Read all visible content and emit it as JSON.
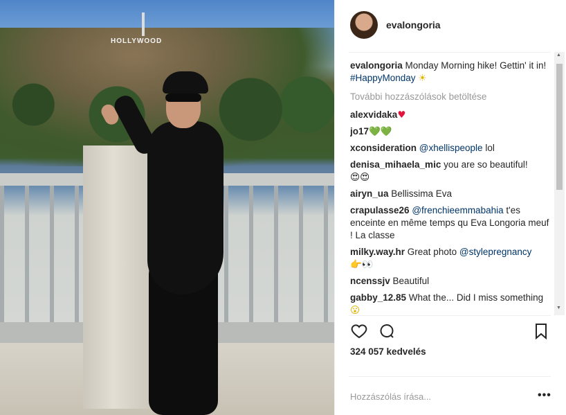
{
  "post": {
    "username": "evalongoria",
    "caption_user": "evalongoria",
    "caption_text": " Monday Morning hike! Gettin' it in! ",
    "caption_tag": "#HappyMonday",
    "caption_emoji": "☀",
    "load_more": "További hozzászólások betöltése"
  },
  "comments": [
    {
      "user": "alexvidaka",
      "text": "",
      "mention": "",
      "emoji": "♥"
    },
    {
      "user": "jo17",
      "text": "",
      "mention": "",
      "emoji": "💚💚"
    },
    {
      "user": "xconsideration",
      "text": " lol",
      "mention": "@xhellispeople",
      "emoji": ""
    },
    {
      "user": "denisa_mihaela_mic",
      "text": " you are so beautiful!",
      "mention": "",
      "emoji": "😍😍"
    },
    {
      "user": "airyn_ua",
      "text": " Bellissima Eva",
      "mention": "",
      "emoji": ""
    },
    {
      "user": "crapulasse26",
      "text": " t'es enceinte en même temps qu Eva Longoria meuf ! La classe",
      "mention": "@frenchieemmabahia",
      "emoji": ""
    },
    {
      "user": "milky.way.hr",
      "text": " Great photo ",
      "mention": "@stylepregnancy",
      "emoji": "👉👀"
    },
    {
      "user": "ncenssjv",
      "text": " Beautiful",
      "mention": "",
      "emoji": ""
    },
    {
      "user": "gabby_12.85",
      "text": " What the... Did I miss something",
      "mention": "",
      "emoji": "😮"
    }
  ],
  "actions": {
    "like_icon": "heart-icon",
    "comment_icon": "comment-icon",
    "save_icon": "bookmark-icon"
  },
  "likes_text": "324 057 kedvelés",
  "add_comment_placeholder": "Hozzászólás írása...",
  "more_icon": "more-options-icon",
  "photo": {
    "sign_text": "HOLLYWOOD"
  }
}
